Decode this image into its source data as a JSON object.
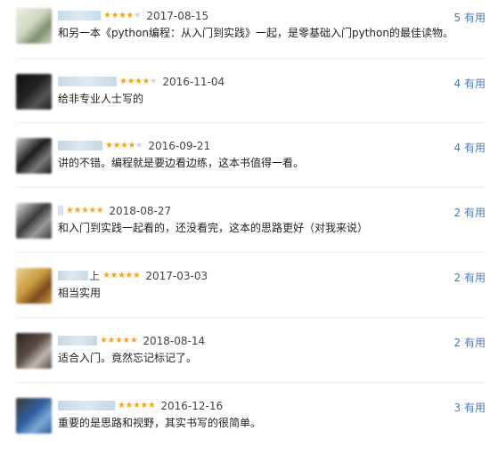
{
  "useful_suffix": "有用",
  "colors": {
    "star_on": "#f5a623",
    "star_off": "#d7d7d7",
    "useful": "#4a7ab7"
  },
  "reviews": [
    {
      "avatar_colors": [
        "#cfd8c2",
        "#7f8f6e",
        "#e9efe4"
      ],
      "username_visible": "",
      "rating": 4,
      "date": "2017-08-15",
      "text": "和另一本《python编程：从入门到实践》一起，是零基础入门python的最佳读物。",
      "useful_count": "5",
      "useful_label": "5 有用"
    },
    {
      "avatar_colors": [
        "#222222",
        "#555555",
        "#111111"
      ],
      "username_visible": "",
      "rating": 4,
      "date": "2016-11-04",
      "text": "给非专业人士写的",
      "useful_count": "4",
      "useful_label": "4 有用"
    },
    {
      "avatar_colors": [
        "#1b1b1b",
        "#7a7a7a",
        "#cfcfcf"
      ],
      "username_visible": "",
      "rating": 4,
      "date": "2016-09-21",
      "text": "讲的不错。编程就是要边看边练，这本书值得一看。",
      "useful_count": "4",
      "useful_label": "4 有用"
    },
    {
      "avatar_colors": [
        "#3a3a3a",
        "#9a9a9a",
        "#e3e3e3"
      ],
      "username_visible": "",
      "rating": 5,
      "date": "2018-08-27",
      "text": "和入门到实践一起看的，还没看完，这本的思路更好（对我来说）",
      "useful_count": "2",
      "useful_label": "2 有用"
    },
    {
      "avatar_colors": [
        "#c99a3b",
        "#7b4a1f",
        "#e8d39a"
      ],
      "username_visible": "上",
      "rating": 5,
      "date": "2017-03-03",
      "text": "相当实用",
      "useful_count": "2",
      "useful_label": "2 有用"
    },
    {
      "avatar_colors": [
        "#5a4d45",
        "#bfb8b2",
        "#2c2522"
      ],
      "username_visible": "",
      "rating": 5,
      "date": "2018-08-14",
      "text": "适合入门。竟然忘记标记了。",
      "useful_count": "2",
      "useful_label": "2 有用"
    },
    {
      "avatar_colors": [
        "#2f5f9f",
        "#7fa7d6",
        "#3b3a33"
      ],
      "username_visible": "",
      "rating": 5,
      "date": "2016-12-16",
      "text": "重要的是思路和视野，其实书写的很简单。",
      "useful_count": "3",
      "useful_label": "3 有用"
    }
  ]
}
